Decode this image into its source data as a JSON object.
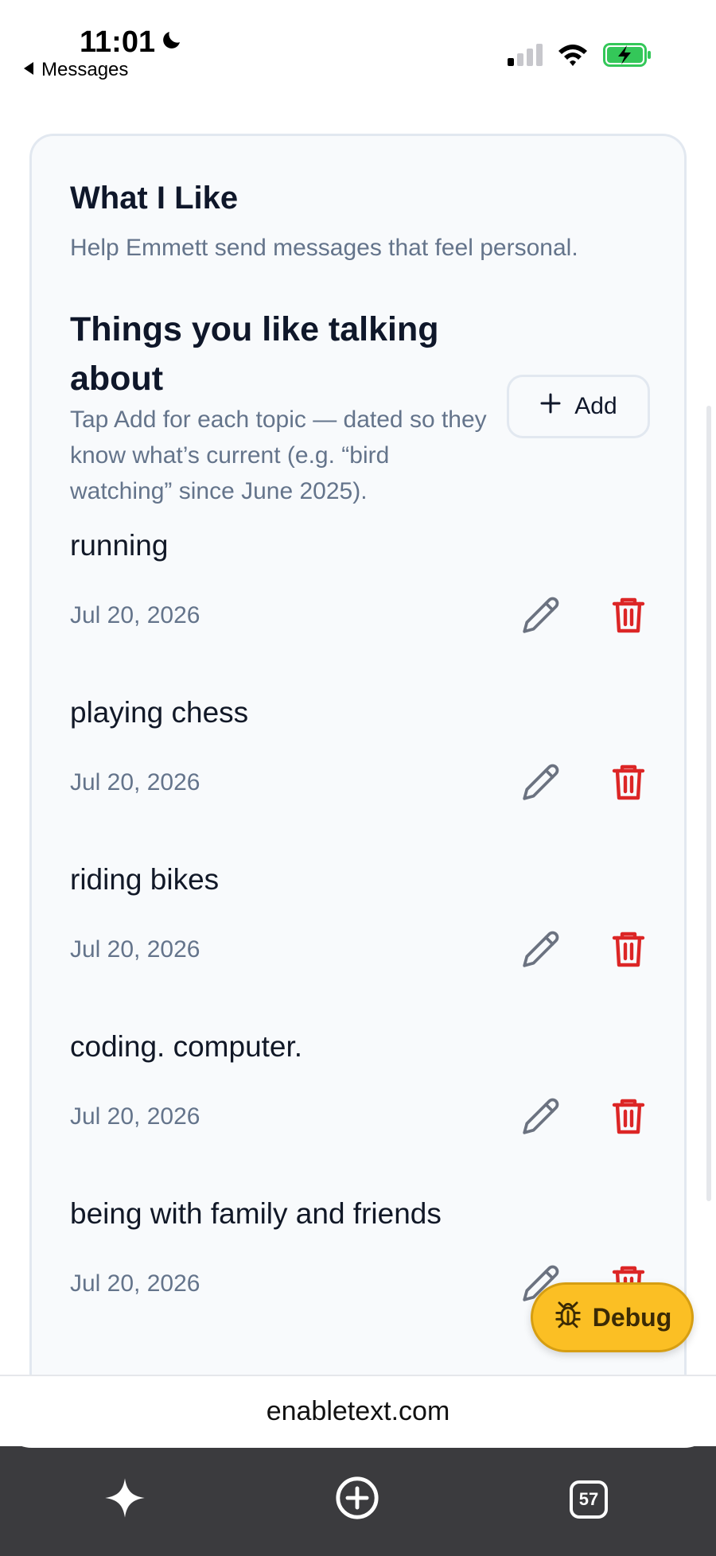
{
  "status_bar": {
    "time": "11:01",
    "back_label": "Messages"
  },
  "card": {
    "title": "What I Like",
    "subtitle": "Help Emmett send messages that feel personal.",
    "section_title": "Things you like talking about",
    "section_help": "Tap Add for each topic — dated so they know what’s current (e.g. “bird watching” since June 2025).",
    "add_label": "Add"
  },
  "topics": [
    {
      "name": "running",
      "date": "Jul 20, 2026"
    },
    {
      "name": "playing chess",
      "date": "Jul 20, 2026"
    },
    {
      "name": "riding bikes",
      "date": "Jul 20, 2026"
    },
    {
      "name": "coding. computer.",
      "date": "Jul 20, 2026"
    },
    {
      "name": "being with family and friends",
      "date": "Jul 20, 2026"
    }
  ],
  "debug": {
    "label": "Debug"
  },
  "browser": {
    "url": "enabletext.com",
    "tab_count": "57"
  },
  "colors": {
    "accent_debug": "#fbbf24",
    "delete_red": "#dc2626",
    "muted_text": "#64748b",
    "battery_green": "#34c759"
  }
}
